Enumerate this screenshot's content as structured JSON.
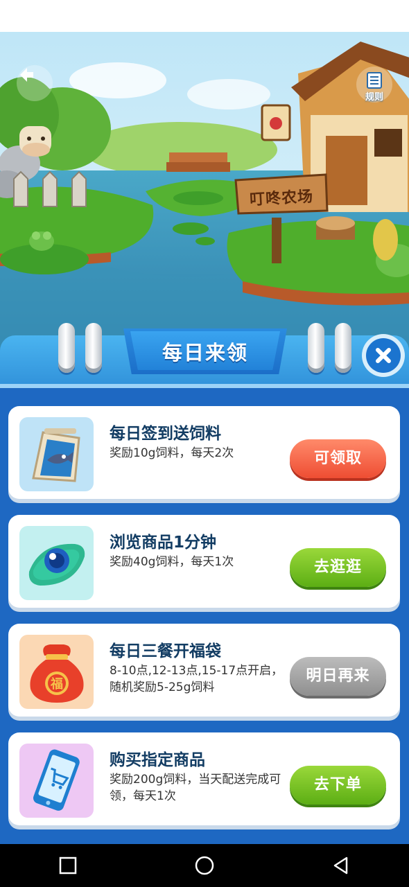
{
  "scene": {
    "sign_text": "叮咚农场",
    "rules_label": "规则",
    "back_icon": "back-arrow-icon",
    "rules_icon": "rules-document-icon"
  },
  "panel": {
    "title": "每日来领",
    "close_icon": "close-icon"
  },
  "tasks": [
    {
      "title": "每日签到送饲料",
      "desc": "奖励10g饲料，每天2次",
      "button": "可领取",
      "button_style": "red",
      "icon": "calendar-fish-icon"
    },
    {
      "title": "浏览商品1分钟",
      "desc": "奖励40g饲料，每天1次",
      "button": "去逛逛",
      "button_style": "green",
      "icon": "eye-icon"
    },
    {
      "title": "每日三餐开福袋",
      "desc": "8-10点,12-13点,15-17点开启，随机奖励5-25g饲料",
      "button": "明日再来",
      "button_style": "gray",
      "icon": "lucky-bag-icon"
    },
    {
      "title": "购买指定商品",
      "desc": "奖励200g饲料，当天配送完成可领，每天1次",
      "button": "去下单",
      "button_style": "green",
      "icon": "shopping-cart-phone-icon"
    }
  ],
  "colors": {
    "panel_blue": "#1e68c2",
    "title_navy": "#123c63",
    "button_red": "#ee4d33",
    "button_green": "#5cae14",
    "button_gray": "#8f8f8f"
  }
}
